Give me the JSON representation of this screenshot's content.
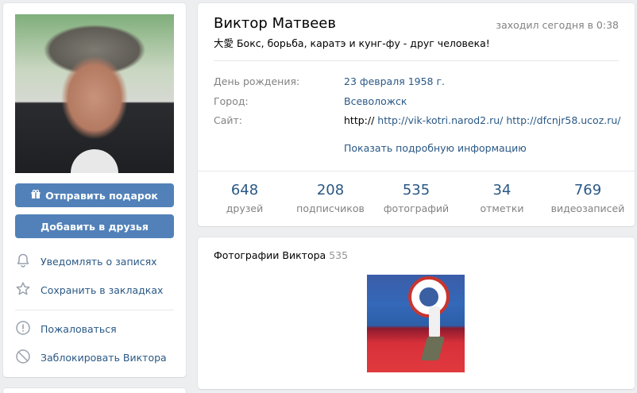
{
  "left": {
    "gift_button": "Отправить подарок",
    "friend_button": "Добавить в друзья",
    "menu": [
      {
        "label": "Уведомлять о записях",
        "icon": "bell-icon"
      },
      {
        "label": "Сохранить в закладках",
        "icon": "star-icon"
      },
      {
        "label": "Пожаловаться",
        "icon": "report-icon"
      },
      {
        "label": "Заблокировать Виктора",
        "icon": "block-icon"
      }
    ]
  },
  "profile": {
    "name": "Виктор Матвеев",
    "last_seen": "заходил сегодня в 0:38",
    "status": "大愛 Бокс, борьба, каратэ и кунг-фу - друг человека!",
    "birthday_label": "День рождения:",
    "birthday_value": "23 февраля 1958 г.",
    "city_label": "Город:",
    "city_value": "Всеволожск",
    "site_label": "Сайт:",
    "site_prefix": "http://",
    "site_link_1": "http://vik-kotri.narod2.ru/",
    "site_link_2": "http://dfcnjr58.ucoz.ru/",
    "more_info": "Показать подробную информацию",
    "counters": [
      {
        "num": "648",
        "label": "друзей"
      },
      {
        "num": "208",
        "label": "подписчиков"
      },
      {
        "num": "535",
        "label": "фотографий"
      },
      {
        "num": "34",
        "label": "отметки"
      },
      {
        "num": "769",
        "label": "видеозаписей"
      }
    ]
  },
  "photos": {
    "title": "Фотографии Виктора",
    "count": "535"
  },
  "colors": {
    "accent": "#5181b8",
    "link": "#2a5885",
    "muted": "#828282",
    "background": "#edeef0"
  }
}
